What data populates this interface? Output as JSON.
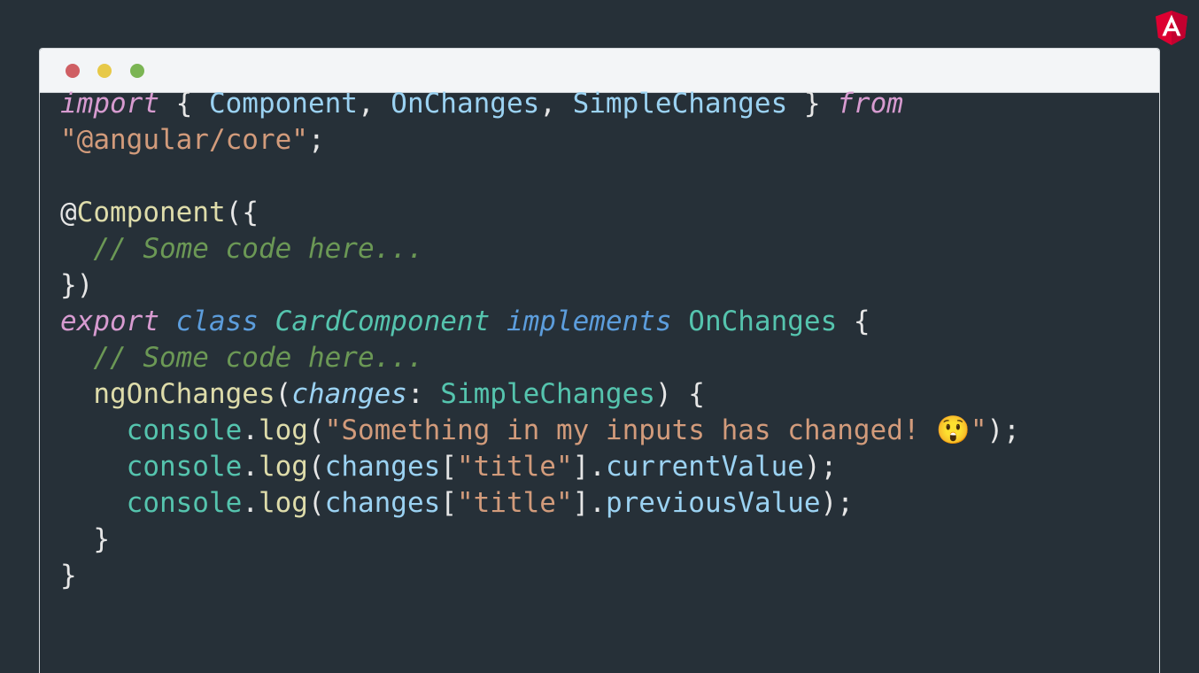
{
  "logo": {
    "name": "angular-logo",
    "color": "#dd0031"
  },
  "window": {
    "controls": [
      "close",
      "minimize",
      "maximize"
    ],
    "colors": {
      "close": "#cf5f64",
      "minimize": "#e7c948",
      "maximize": "#7bb554"
    }
  },
  "code": {
    "language": "typescript",
    "lines": [
      [
        {
          "t": "import",
          "c": "kw"
        },
        {
          "t": " { ",
          "c": "pn"
        },
        {
          "t": "Component",
          "c": "id"
        },
        {
          "t": ", ",
          "c": "pn"
        },
        {
          "t": "OnChanges",
          "c": "id"
        },
        {
          "t": ", ",
          "c": "pn"
        },
        {
          "t": "SimpleChanges",
          "c": "id"
        },
        {
          "t": " } ",
          "c": "pn"
        },
        {
          "t": "from",
          "c": "kw"
        }
      ],
      [
        {
          "t": "\"@angular/core\"",
          "c": "st"
        },
        {
          "t": ";",
          "c": "pn"
        }
      ],
      [],
      [
        {
          "t": "@",
          "c": "pn"
        },
        {
          "t": "Component",
          "c": "fn"
        },
        {
          "t": "({",
          "c": "pn"
        }
      ],
      [
        {
          "t": "  ",
          "c": "pn"
        },
        {
          "t": "// Some code here...",
          "c": "cm"
        }
      ],
      [
        {
          "t": "})",
          "c": "pn"
        }
      ],
      [
        {
          "t": "export",
          "c": "kw"
        },
        {
          "t": " ",
          "c": "pn"
        },
        {
          "t": "class",
          "c": "cls"
        },
        {
          "t": " ",
          "c": "pn"
        },
        {
          "t": "CardComponent",
          "c": "tyi"
        },
        {
          "t": " ",
          "c": "pn"
        },
        {
          "t": "implements",
          "c": "cls"
        },
        {
          "t": " ",
          "c": "pn"
        },
        {
          "t": "OnChanges",
          "c": "ty"
        },
        {
          "t": " {",
          "c": "pn"
        }
      ],
      [
        {
          "t": "  ",
          "c": "pn"
        },
        {
          "t": "// Some code here...",
          "c": "cm"
        }
      ],
      [
        {
          "t": "  ",
          "c": "pn"
        },
        {
          "t": "ngOnChanges",
          "c": "fn"
        },
        {
          "t": "(",
          "c": "pn"
        },
        {
          "t": "changes",
          "c": "param"
        },
        {
          "t": ": ",
          "c": "pn"
        },
        {
          "t": "SimpleChanges",
          "c": "ty"
        },
        {
          "t": ") {",
          "c": "pn"
        }
      ],
      [
        {
          "t": "    ",
          "c": "pn"
        },
        {
          "t": "console",
          "c": "ty"
        },
        {
          "t": ".",
          "c": "pn"
        },
        {
          "t": "log",
          "c": "fn"
        },
        {
          "t": "(",
          "c": "pn"
        },
        {
          "t": "\"Something in my inputs has changed! ",
          "c": "st"
        },
        {
          "t": "😲",
          "c": "emoji"
        },
        {
          "t": "\"",
          "c": "st"
        },
        {
          "t": ");",
          "c": "pn"
        }
      ],
      [
        {
          "t": "    ",
          "c": "pn"
        },
        {
          "t": "console",
          "c": "ty"
        },
        {
          "t": ".",
          "c": "pn"
        },
        {
          "t": "log",
          "c": "fn"
        },
        {
          "t": "(",
          "c": "pn"
        },
        {
          "t": "changes",
          "c": "id"
        },
        {
          "t": "[",
          "c": "pn"
        },
        {
          "t": "\"title\"",
          "c": "st"
        },
        {
          "t": "].",
          "c": "pn"
        },
        {
          "t": "currentValue",
          "c": "id"
        },
        {
          "t": ");",
          "c": "pn"
        }
      ],
      [
        {
          "t": "    ",
          "c": "pn"
        },
        {
          "t": "console",
          "c": "ty"
        },
        {
          "t": ".",
          "c": "pn"
        },
        {
          "t": "log",
          "c": "fn"
        },
        {
          "t": "(",
          "c": "pn"
        },
        {
          "t": "changes",
          "c": "id"
        },
        {
          "t": "[",
          "c": "pn"
        },
        {
          "t": "\"title\"",
          "c": "st"
        },
        {
          "t": "].",
          "c": "pn"
        },
        {
          "t": "previousValue",
          "c": "id"
        },
        {
          "t": ");",
          "c": "pn"
        }
      ],
      [
        {
          "t": "  }",
          "c": "pn"
        }
      ],
      [
        {
          "t": "}",
          "c": "pn"
        }
      ]
    ]
  }
}
